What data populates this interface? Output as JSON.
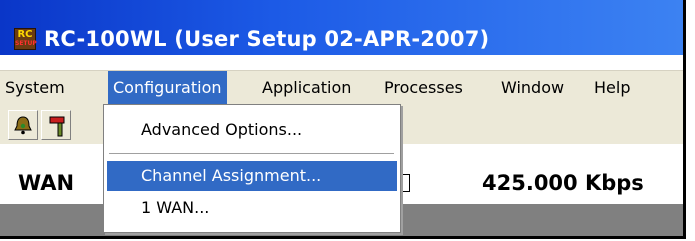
{
  "window": {
    "title": "RC-100WL (User Setup 02-APR-2007)",
    "icon_text": "RC",
    "icon_subtext": "SETUP"
  },
  "menubar": {
    "items": [
      {
        "label": "System"
      },
      {
        "label": "Configuration"
      },
      {
        "label": "Application"
      },
      {
        "label": "Processes"
      },
      {
        "label": "Window"
      },
      {
        "label": "Help"
      }
    ],
    "active": "Configuration"
  },
  "dropdown": {
    "items": [
      {
        "label": "Advanced Options..."
      },
      {
        "label": "Channel Assignment..."
      },
      {
        "label": "1 WAN..."
      }
    ],
    "highlighted": "Channel Assignment..."
  },
  "toolbar": {
    "icons": [
      "bell-icon",
      "hammer-icon"
    ]
  },
  "status": {
    "label": "WAN",
    "rate": "425.000 Kbps"
  },
  "colors": {
    "title_bar": "#0a36c8",
    "highlight": "#316ac5",
    "menubar_bg": "#ece9d8"
  }
}
